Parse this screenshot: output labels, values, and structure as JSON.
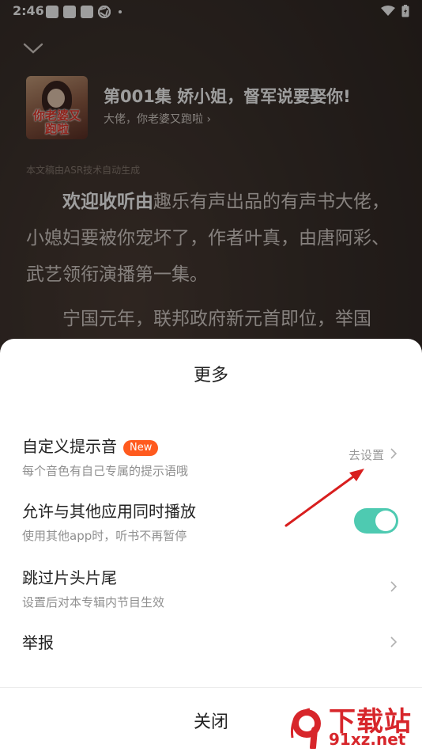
{
  "status_bar": {
    "time": "2:46"
  },
  "player": {
    "cover_text": "你老婆又跑啦",
    "episode_title": "第001集 娇小姐，督军说要娶你!",
    "album_link": "大佬，你老婆又跑啦 ›",
    "asr_note": "本文稿由ASR技术自动生成",
    "transcript": {
      "lead": "欢迎收听由",
      "para1_rest": "趣乐有声出品的有声书大佬，小媳妇要被你宠坏了，作者叶真，由唐阿彩、武艺领衔演播第一集。",
      "para2": "宁国元年，联邦政府新元首即位，举国"
    }
  },
  "sheet": {
    "title": "更多",
    "items": [
      {
        "title": "自定义提示音",
        "badge": "New",
        "subtitle": "每个音色有自己专属的提示语哦",
        "action": "去设置"
      },
      {
        "title": "允许与其他应用同时播放",
        "subtitle": "使用其他app时，听书不再暂停",
        "toggle_on": true
      },
      {
        "title": "跳过片头片尾",
        "subtitle": "设置后对本专辑内节目生效"
      },
      {
        "title": "举报"
      }
    ],
    "close_label": "关闭"
  },
  "watermark": {
    "main": "下载站",
    "url": "91xz.net"
  },
  "colors": {
    "accent_toggle": "#4ecab1",
    "badge": "#ff5a1e",
    "annotation_arrow": "#d81e1e"
  }
}
